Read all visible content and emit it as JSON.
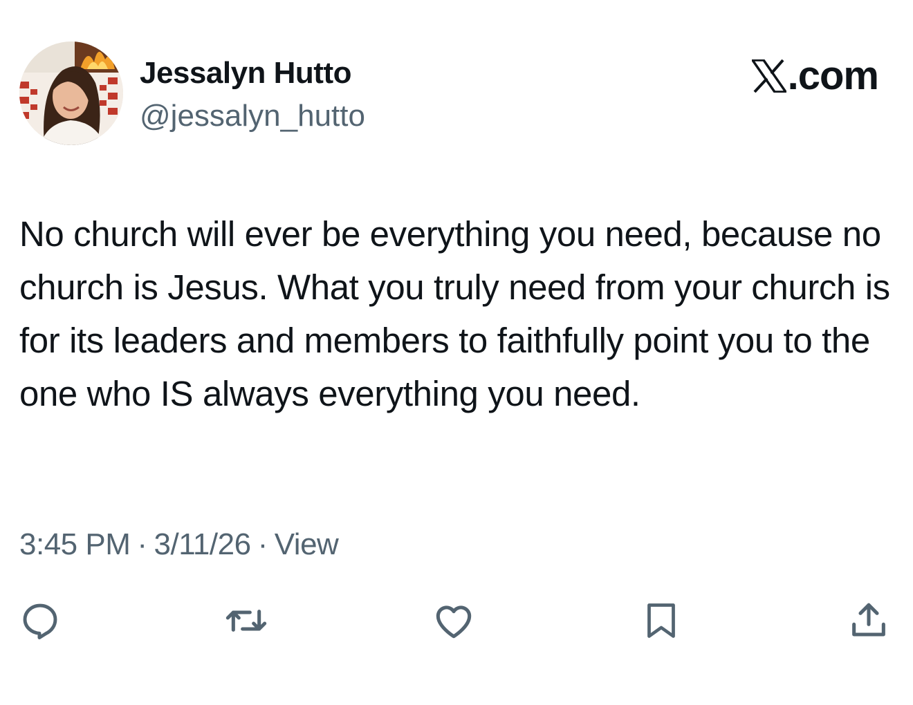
{
  "author": {
    "display_name": "Jessalyn Hutto",
    "handle": "@jessalyn_hutto"
  },
  "brand": {
    "suffix": ".com",
    "logo_icon": "x-logo-icon"
  },
  "tweet": {
    "text": "No church will ever be everything you need, because no church is Jesus. What you truly need from your church is for its leaders and members to faithfully point you to the one who IS always everything you need."
  },
  "meta": {
    "time": "3:45 PM",
    "separator": "·",
    "date": "3/11/26",
    "views_label": "View"
  },
  "actions": [
    {
      "name": "reply",
      "icon": "reply-icon"
    },
    {
      "name": "repost",
      "icon": "repost-icon"
    },
    {
      "name": "like",
      "icon": "heart-icon"
    },
    {
      "name": "bookmark",
      "icon": "bookmark-icon"
    },
    {
      "name": "share",
      "icon": "share-icon"
    }
  ],
  "colors": {
    "text_primary": "#0f1419",
    "text_secondary": "#536471",
    "background": "#ffffff"
  }
}
